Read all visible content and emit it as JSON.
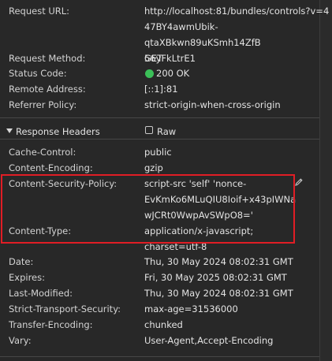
{
  "general": {
    "request_url": {
      "label": "Request URL:",
      "value": "http://localhost:81/bundles/controls?v=4\n47BY4awmUbik-qtaXBkwn89uKSmh14ZfB\n56yFkLtrE1"
    },
    "request_method": {
      "label": "Request Method:",
      "value": "GET"
    },
    "status_code": {
      "label": "Status Code:",
      "value": "200 OK"
    },
    "remote_address": {
      "label": "Remote Address:",
      "value": "[::1]:81"
    },
    "referrer_policy": {
      "label": "Referrer Policy:",
      "value": "strict-origin-when-cross-origin"
    }
  },
  "response_headers": {
    "title": "Response Headers",
    "raw_label": "Raw",
    "raw_checked": false,
    "items": [
      {
        "label": "Cache-Control:",
        "value": "public"
      },
      {
        "label": "Content-Encoding:",
        "value": "gzip"
      },
      {
        "label": "Content-Security-Policy:",
        "value": "script-src 'self' 'nonce-\nEvKmKo6MLuQIU8Ioif+x43pIWNa\nwJCRt0WwpAvSWpO8='"
      },
      {
        "label": "Content-Type:",
        "value": "application/x-javascript;\ncharset=utf-8"
      },
      {
        "label": "Date:",
        "value": "Thu, 30 May 2024 08:02:31 GMT"
      },
      {
        "label": "Expires:",
        "value": "Fri, 30 May 2025 08:02:31 GMT"
      },
      {
        "label": "Last-Modified:",
        "value": "Thu, 30 May 2024 08:02:31 GMT"
      },
      {
        "label": "Strict-Transport-Security:",
        "value": "max-age=31536000"
      },
      {
        "label": "Transfer-Encoding:",
        "value": "chunked"
      },
      {
        "label": "Vary:",
        "value": "User-Agent,Accept-Encoding"
      }
    ]
  },
  "colors": {
    "background": "#282828",
    "text": "#e3e3e3",
    "divider": "#474747",
    "status_ok": "#3bbf58",
    "highlight": "#e11d25"
  },
  "icons": {
    "edit": "pencil-icon",
    "section_toggle": "caret-down-icon",
    "raw_toggle": "checkbox-icon",
    "status": "status-ok-dot-icon"
  }
}
